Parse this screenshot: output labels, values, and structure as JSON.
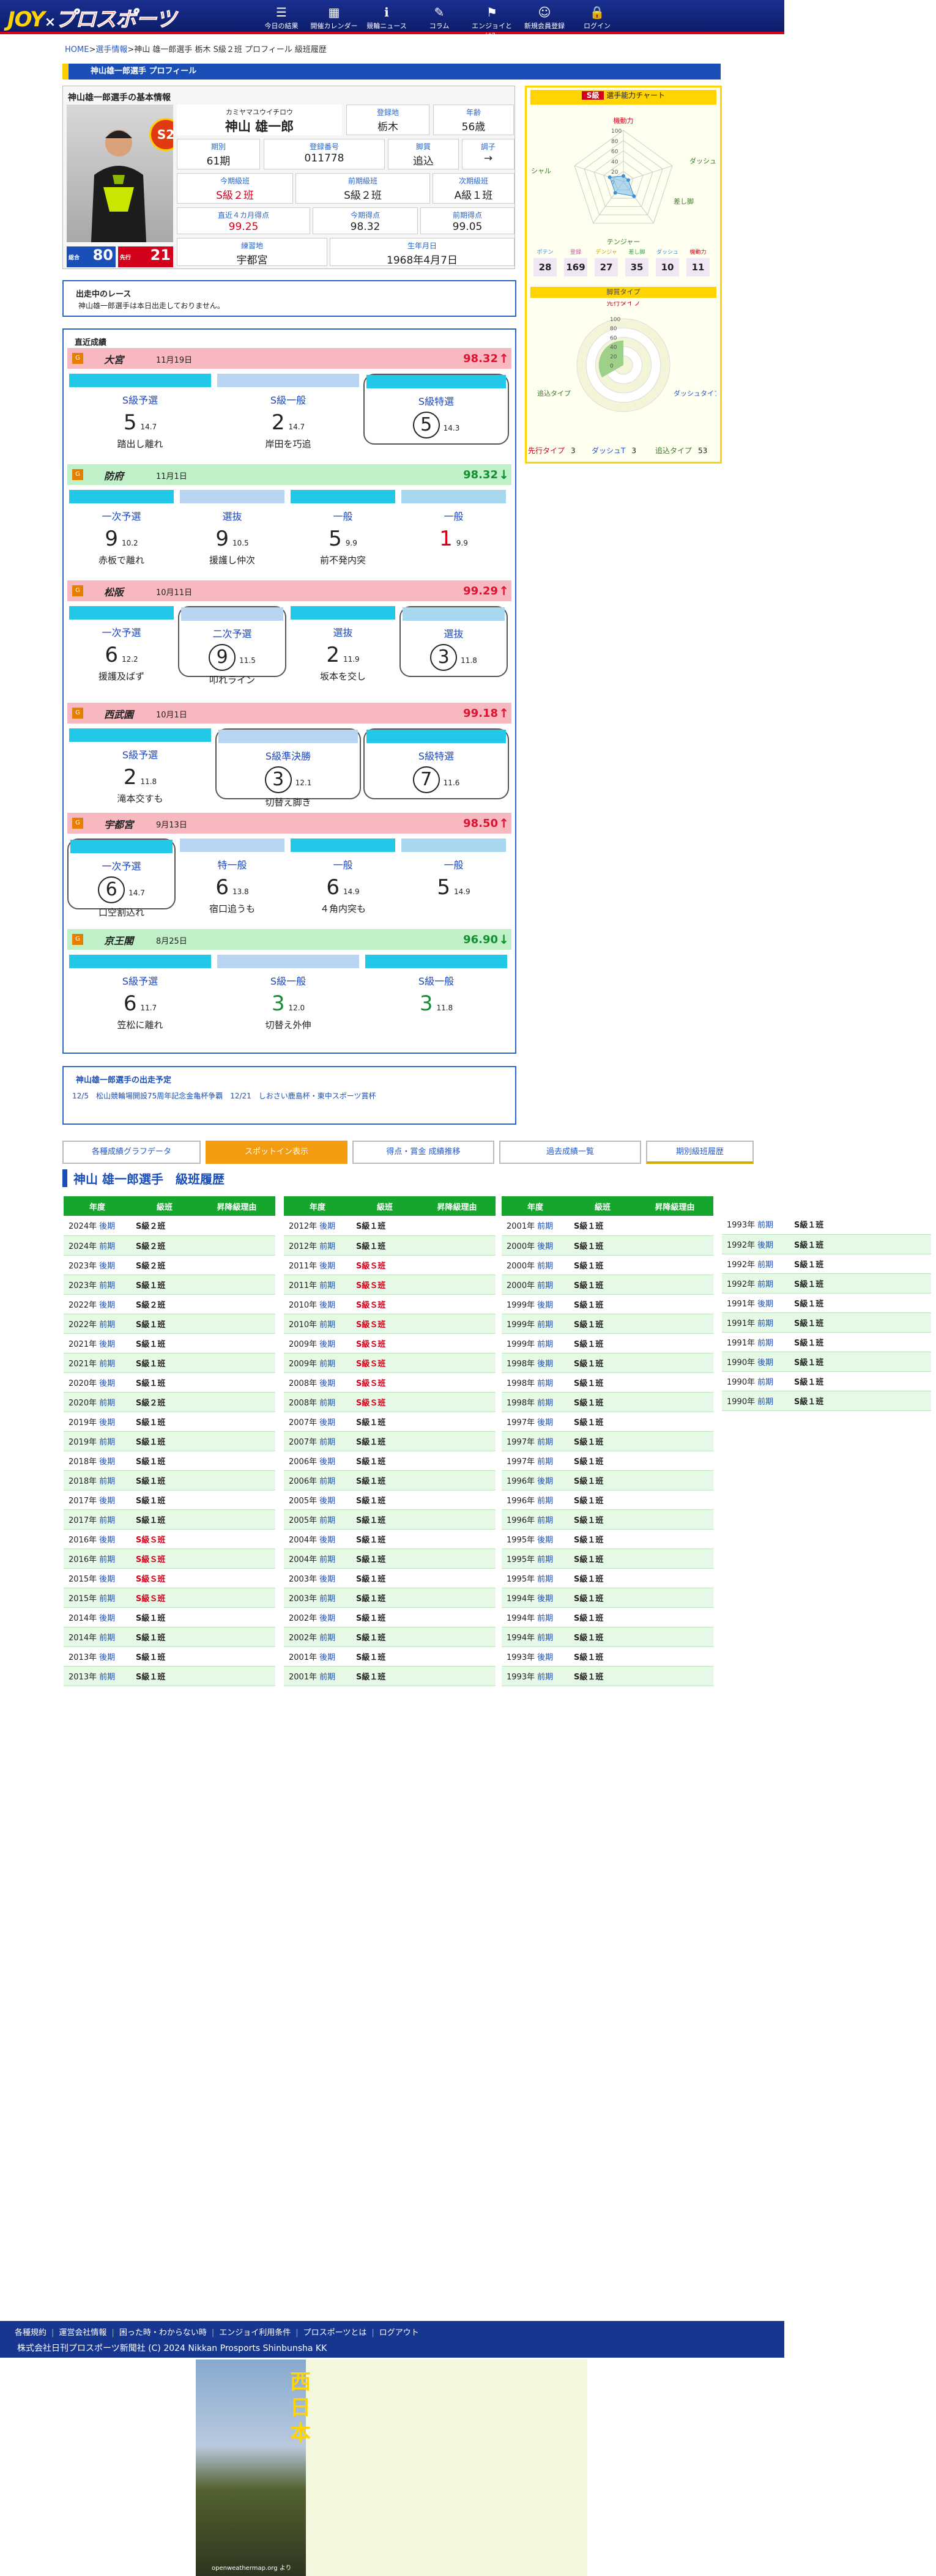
{
  "header": {
    "logo_a": "JOY",
    "logo_x": "×",
    "logo_b": "プロスポーツ",
    "nav": [
      {
        "label": "今日の結果",
        "icon": "list-icon"
      },
      {
        "label": "開催カレンダー",
        "icon": "calendar-icon"
      },
      {
        "label": "競輪ニュース",
        "icon": "info-icon"
      },
      {
        "label": "コラム",
        "icon": "pen-icon"
      },
      {
        "label": "エンジョイとは？",
        "icon": "flag-icon"
      },
      {
        "label": "新規会員登録",
        "icon": "user-plus-icon"
      },
      {
        "label": "ログイン",
        "icon": "lock-icon"
      }
    ]
  },
  "breadcrumb": {
    "home": "HOME",
    "sep": ">",
    "list": "選手情報",
    "rest": ">神山 雄一郎選手 栃木 S級２班 プロフィール 級班履歴"
  },
  "page_title": "神山雄一郎選手 プロフィール",
  "profile": {
    "section": "神山雄一郎選手の基本情報",
    "rank": "S2",
    "kana": "カミヤマユウイチロウ",
    "name": "神山 雄一郎",
    "fields": [
      {
        "label": "登録地",
        "value": "栃木"
      },
      {
        "label": "年齢",
        "value": "56歳"
      },
      {
        "label": "期別",
        "value": "61期"
      },
      {
        "label": "登録番号",
        "value": "011778"
      },
      {
        "label": "脚質",
        "value": "追込"
      },
      {
        "label": "調子",
        "value": "→"
      },
      {
        "label": "今期級班",
        "value": "S級２班"
      },
      {
        "label": "前期級班",
        "value": "S級２班"
      },
      {
        "label": "次期級班",
        "value": "A級１班"
      },
      {
        "label": "直近４カ月得点",
        "value": "99.25"
      },
      {
        "label": "今期得点",
        "value": "98.32"
      },
      {
        "label": "前期得点",
        "value": "99.05"
      },
      {
        "label": "練習地",
        "value": "宇都宮"
      },
      {
        "label": "生年月日",
        "value": "1968年4月7日"
      }
    ],
    "badge1": "80",
    "badge1_label": "総合",
    "badge2": "21",
    "badge2_label": "先行"
  },
  "radar": {
    "title": "S級",
    "subtitle": "選手能力チャート",
    "axes": [
      "機動力",
      "ダッシュ",
      "差し脚",
      "テンジャー",
      "ポテンシャル"
    ],
    "ticks": [
      "100",
      "80",
      "60",
      "40",
      "20",
      "0"
    ],
    "stats": [
      {
        "label": "ポテン",
        "value": "28"
      },
      {
        "label": "登録",
        "value": "169"
      },
      {
        "label": "デンジャ",
        "value": "27"
      },
      {
        "label": "差し脚",
        "value": "35"
      },
      {
        "label": "ダッシュ",
        "value": "10"
      },
      {
        "label": "機動力",
        "value": "11"
      }
    ],
    "type_title": "脚質タイプ",
    "type_axes": [
      "先行タイプ",
      "ダッシュタイプ",
      "追込タイプ"
    ],
    "legend": [
      {
        "label": "先行タイプ",
        "value": "3"
      },
      {
        "label": "ダッシュT",
        "value": "3"
      },
      {
        "label": "追込タイプ",
        "value": "53"
      }
    ]
  },
  "current_race": {
    "title": "出走中のレース",
    "text": "神山雄一郎選手は本日出走しておりません。"
  },
  "recent": {
    "title": "直近成績",
    "races": [
      {
        "venue": "大宮",
        "date": "11月19日",
        "score": "98.32",
        "up": "↑",
        "color": "#f8b8c0",
        "sc": "#e01030",
        "results": [
          {
            "name": "S級予選",
            "place": "5",
            "st": "14.7",
            "comment": "踏出し離れ",
            "hl": false
          },
          {
            "name": "S級一般",
            "place": "2",
            "st": "14.7",
            "comment": "岸田を巧追",
            "hl": false
          },
          {
            "name": "S級特選",
            "place": "5",
            "st": "14.3",
            "comment": "",
            "hl": true
          }
        ]
      },
      {
        "venue": "防府",
        "date": "11月1日",
        "score": "98.32",
        "up": "↓",
        "color": "#c0f0c8",
        "sc": "#109030",
        "results": [
          {
            "name": "一次予選",
            "place": "9",
            "st": "10.2",
            "comment": "赤板で離れ",
            "hl": false
          },
          {
            "name": "選抜",
            "place": "9",
            "st": "10.5",
            "comment": "援護し仲次",
            "hl": false
          },
          {
            "name": "一般",
            "place": "5",
            "st": "9.9",
            "comment": "前不発内突",
            "hl": false
          },
          {
            "name": "一般",
            "place": "1",
            "st": "9.9",
            "comment": "",
            "hl": false
          }
        ]
      },
      {
        "venue": "松阪",
        "date": "10月11日",
        "score": "99.29",
        "up": "↑",
        "color": "#f8b8c0",
        "sc": "#e01030",
        "results": [
          {
            "name": "一次予選",
            "place": "6",
            "st": "12.2",
            "comment": "援護及ばず",
            "hl": false
          },
          {
            "name": "二次予選",
            "place": "9",
            "st": "11.5",
            "comment": "叩れライン",
            "hl": true
          },
          {
            "name": "選抜",
            "place": "2",
            "st": "11.9",
            "comment": "坂本を交し",
            "hl": false
          },
          {
            "name": "選抜",
            "place": "3",
            "st": "11.8",
            "comment": "",
            "hl": true
          }
        ]
      },
      {
        "venue": "西武園",
        "date": "10月1日",
        "score": "99.18",
        "up": "↑",
        "color": "#f8b8c0",
        "sc": "#e01030",
        "results": [
          {
            "name": "S級予選",
            "place": "2",
            "st": "11.8",
            "comment": "滝本交すも",
            "hl": false
          },
          {
            "name": "S級準決勝",
            "place": "3",
            "st": "12.1",
            "comment": "切替え脚き",
            "hl": true
          },
          {
            "name": "S級特選",
            "place": "7",
            "st": "11.6",
            "comment": "",
            "hl": true
          }
        ]
      },
      {
        "venue": "宇都宮",
        "date": "9月13日",
        "score": "98.50",
        "up": "↑",
        "color": "#f8b8c0",
        "sc": "#e01030",
        "results": [
          {
            "name": "一次予選",
            "place": "6",
            "st": "14.7",
            "comment": "口空割込れ",
            "hl": true
          },
          {
            "name": "特一般",
            "place": "6",
            "st": "13.8",
            "comment": "宿口追うも",
            "hl": false
          },
          {
            "name": "一般",
            "place": "6",
            "st": "14.9",
            "comment": "４角内突も",
            "hl": false
          },
          {
            "name": "一般",
            "place": "5",
            "st": "14.9",
            "comment": "",
            "hl": false
          }
        ]
      },
      {
        "venue": "京王閣",
        "date": "8月25日",
        "score": "96.90",
        "up": "↓",
        "color": "#c0f0c8",
        "sc": "#109030",
        "results": [
          {
            "name": "S級予選",
            "place": "6",
            "st": "11.7",
            "comment": "笠松に離れ",
            "hl": false
          },
          {
            "name": "S級一般",
            "place": "3",
            "st": "12.0",
            "comment": "切替え外伸",
            "hl": false
          },
          {
            "name": "S級一般",
            "place": "3",
            "st": "11.8",
            "comment": "",
            "hl": false
          }
        ]
      }
    ]
  },
  "upcoming": {
    "title": "神山雄一郎選手の出走予定",
    "line": "12/5　松山競輪場開設75周年記念金亀杯争覇　12/21　しおさい鹿島杯・東中スポーツ賞杯"
  },
  "tabs": [
    "各種成績グラフデータ",
    "スポットイン表示",
    "得点・賞金 成績推移",
    "過去成績一覧",
    "期別級班履歴"
  ],
  "history": {
    "title": "神山 雄一郎選手　級班履歴",
    "cols": [
      "年度",
      "級班",
      "昇降級理由"
    ],
    "t1": [
      [
        "2024年",
        "後期",
        "S級２班"
      ],
      [
        "2024年",
        "前期",
        "S級２班"
      ],
      [
        "2023年",
        "後期",
        "S級２班"
      ],
      [
        "2023年",
        "前期",
        "S級１班"
      ],
      [
        "2022年",
        "後期",
        "S級２班"
      ],
      [
        "2022年",
        "前期",
        "S級１班"
      ],
      [
        "2021年",
        "後期",
        "S級１班"
      ],
      [
        "2021年",
        "前期",
        "S級１班"
      ],
      [
        "2020年",
        "後期",
        "S級１班"
      ],
      [
        "2020年",
        "前期",
        "S級２班"
      ],
      [
        "2019年",
        "後期",
        "S級１班"
      ],
      [
        "2019年",
        "前期",
        "S級１班"
      ],
      [
        "2018年",
        "後期",
        "S級１班"
      ],
      [
        "2018年",
        "前期",
        "S級１班"
      ],
      [
        "2017年",
        "後期",
        "S級１班"
      ],
      [
        "2017年",
        "前期",
        "S級１班"
      ],
      [
        "2016年",
        "後期",
        "S級Ｓ班"
      ],
      [
        "2016年",
        "前期",
        "S級Ｓ班"
      ],
      [
        "2015年",
        "後期",
        "S級Ｓ班"
      ],
      [
        "2015年",
        "前期",
        "S級Ｓ班"
      ],
      [
        "2014年",
        "後期",
        "S級１班"
      ],
      [
        "2014年",
        "前期",
        "S級１班"
      ],
      [
        "2013年",
        "後期",
        "S級１班"
      ],
      [
        "2013年",
        "前期",
        "S級１班"
      ]
    ],
    "t2": [
      [
        "2012年",
        "後期",
        "S級１班"
      ],
      [
        "2012年",
        "前期",
        "S級１班"
      ],
      [
        "2011年",
        "後期",
        "S級Ｓ班"
      ],
      [
        "2011年",
        "前期",
        "S級Ｓ班"
      ],
      [
        "2010年",
        "後期",
        "S級Ｓ班"
      ],
      [
        "2010年",
        "前期",
        "S級Ｓ班"
      ],
      [
        "2009年",
        "後期",
        "S級Ｓ班"
      ],
      [
        "2009年",
        "前期",
        "S級Ｓ班"
      ],
      [
        "2008年",
        "後期",
        "S級Ｓ班"
      ],
      [
        "2008年",
        "前期",
        "S級Ｓ班"
      ],
      [
        "2007年",
        "後期",
        "S級１班"
      ],
      [
        "2007年",
        "前期",
        "S級１班"
      ],
      [
        "2006年",
        "後期",
        "S級１班"
      ],
      [
        "2006年",
        "前期",
        "S級１班"
      ],
      [
        "2005年",
        "後期",
        "S級１班"
      ],
      [
        "2005年",
        "前期",
        "S級１班"
      ],
      [
        "2004年",
        "後期",
        "S級１班"
      ],
      [
        "2004年",
        "前期",
        "S級１班"
      ],
      [
        "2003年",
        "後期",
        "S級１班"
      ],
      [
        "2003年",
        "前期",
        "S級１班"
      ],
      [
        "2002年",
        "後期",
        "S級１班"
      ],
      [
        "2002年",
        "前期",
        "S級１班"
      ],
      [
        "2001年",
        "後期",
        "S級１班"
      ],
      [
        "2001年",
        "前期",
        "S級１班"
      ]
    ],
    "t3": [
      [
        "2001年",
        "前期",
        "S級１班"
      ],
      [
        "2000年",
        "後期",
        "S級１班"
      ],
      [
        "2000年",
        "前期",
        "S級１班"
      ],
      [
        "2000年",
        "前期",
        "S級１班"
      ],
      [
        "1999年",
        "後期",
        "S級１班"
      ],
      [
        "1999年",
        "前期",
        "S級１班"
      ],
      [
        "1999年",
        "前期",
        "S級１班"
      ],
      [
        "1998年",
        "後期",
        "S級１班"
      ],
      [
        "1998年",
        "前期",
        "S級１班"
      ],
      [
        "1998年",
        "前期",
        "S級１班"
      ],
      [
        "1997年",
        "後期",
        "S級１班"
      ],
      [
        "1997年",
        "前期",
        "S級１班"
      ],
      [
        "1997年",
        "前期",
        "S級１班"
      ],
      [
        "1996年",
        "後期",
        "S級１班"
      ],
      [
        "1996年",
        "前期",
        "S級１班"
      ],
      [
        "1996年",
        "前期",
        "S級１班"
      ],
      [
        "1995年",
        "後期",
        "S級１班"
      ],
      [
        "1995年",
        "前期",
        "S級１班"
      ],
      [
        "1995年",
        "前期",
        "S級１班"
      ],
      [
        "1994年",
        "後期",
        "S級１班"
      ],
      [
        "1994年",
        "前期",
        "S級１班"
      ],
      [
        "1994年",
        "前期",
        "S級１班"
      ],
      [
        "1993年",
        "後期",
        "S級１班"
      ],
      [
        "1993年",
        "前期",
        "S級１班"
      ]
    ],
    "t4": [
      [
        "1993年",
        "前期",
        "S級１班"
      ],
      [
        "1992年",
        "後期",
        "S級１班"
      ],
      [
        "1992年",
        "前期",
        "S級１班"
      ],
      [
        "1992年",
        "前期",
        "S級１班"
      ],
      [
        "1991年",
        "後期",
        "S級１班"
      ],
      [
        "1991年",
        "前期",
        "S級１班"
      ],
      [
        "1991年",
        "前期",
        "S級１班"
      ],
      [
        "1990年",
        "後期",
        "S級１班"
      ],
      [
        "1990年",
        "前期",
        "S級１班"
      ],
      [
        "1990年",
        "前期",
        "S級１班"
      ]
    ]
  },
  "footer": {
    "links": [
      "各種規約",
      "運営会社情報",
      "困った時・わからない時",
      "エンジョイ利用条件",
      "プロスポーツとは",
      "ログアウト"
    ],
    "copyright": "株式会社日刊プロスポーツ新聞社 (C) 2024 Nikkan Prosports Shinbunsha KK"
  },
  "ad": {
    "vertical": "西日本",
    "credit": "openweathermap.org より"
  }
}
